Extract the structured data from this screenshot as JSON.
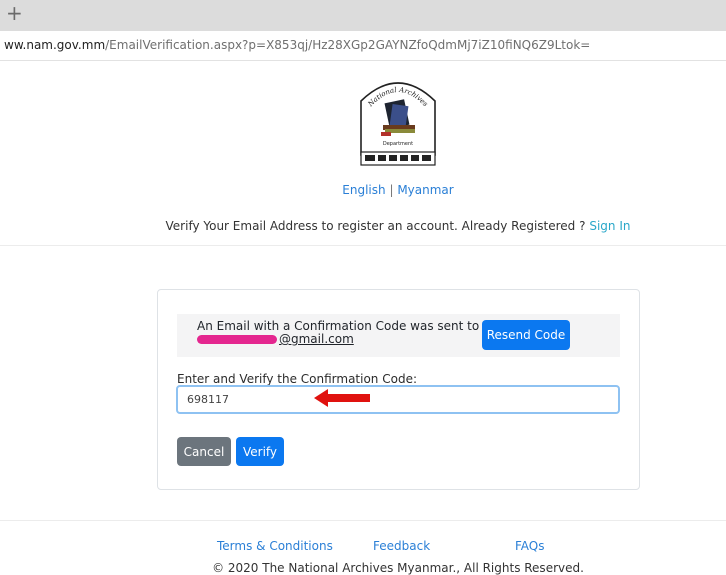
{
  "browser": {
    "new_tab_symbol": "+",
    "url_host": "ww.nam.gov.mm",
    "url_path": "/EmailVerification.aspx?p=X853qj/Hz28XGp2GAYNZfoQdmMj7iZ10fiNQ6Z9Ltok="
  },
  "logo": {
    "top_text": "National Archives",
    "bottom_text": "Department"
  },
  "language": {
    "english": "English",
    "separator": "|",
    "myanmar": "Myanmar"
  },
  "intro": {
    "text": "Verify Your Email Address to register an account. Already Registered ?",
    "signin_link": "Sign In"
  },
  "verification": {
    "notice_text": "An Email with a Confirmation Code was sent to",
    "email_domain": "@gmail.com",
    "resend_label": "Resend Code",
    "code_label": "Enter and Verify the Confirmation Code:",
    "code_value": "698117",
    "cancel_label": "Cancel",
    "verify_label": "Verify"
  },
  "footer": {
    "terms": "Terms & Conditions",
    "feedback": "Feedback",
    "faqs": "FAQs",
    "copyright": "© 2020 The National Archives Myanmar., All Rights Reserved."
  },
  "colors": {
    "primary": "#0b78f0",
    "secondary": "#6c757d",
    "link": "#2a7fd6",
    "annotation_arrow": "#e0120f",
    "redaction": "#e4268f"
  },
  "icons": {
    "new_tab": "plus-icon",
    "annotation": "red-arrow-icon",
    "logo": "national-archives-logo"
  }
}
